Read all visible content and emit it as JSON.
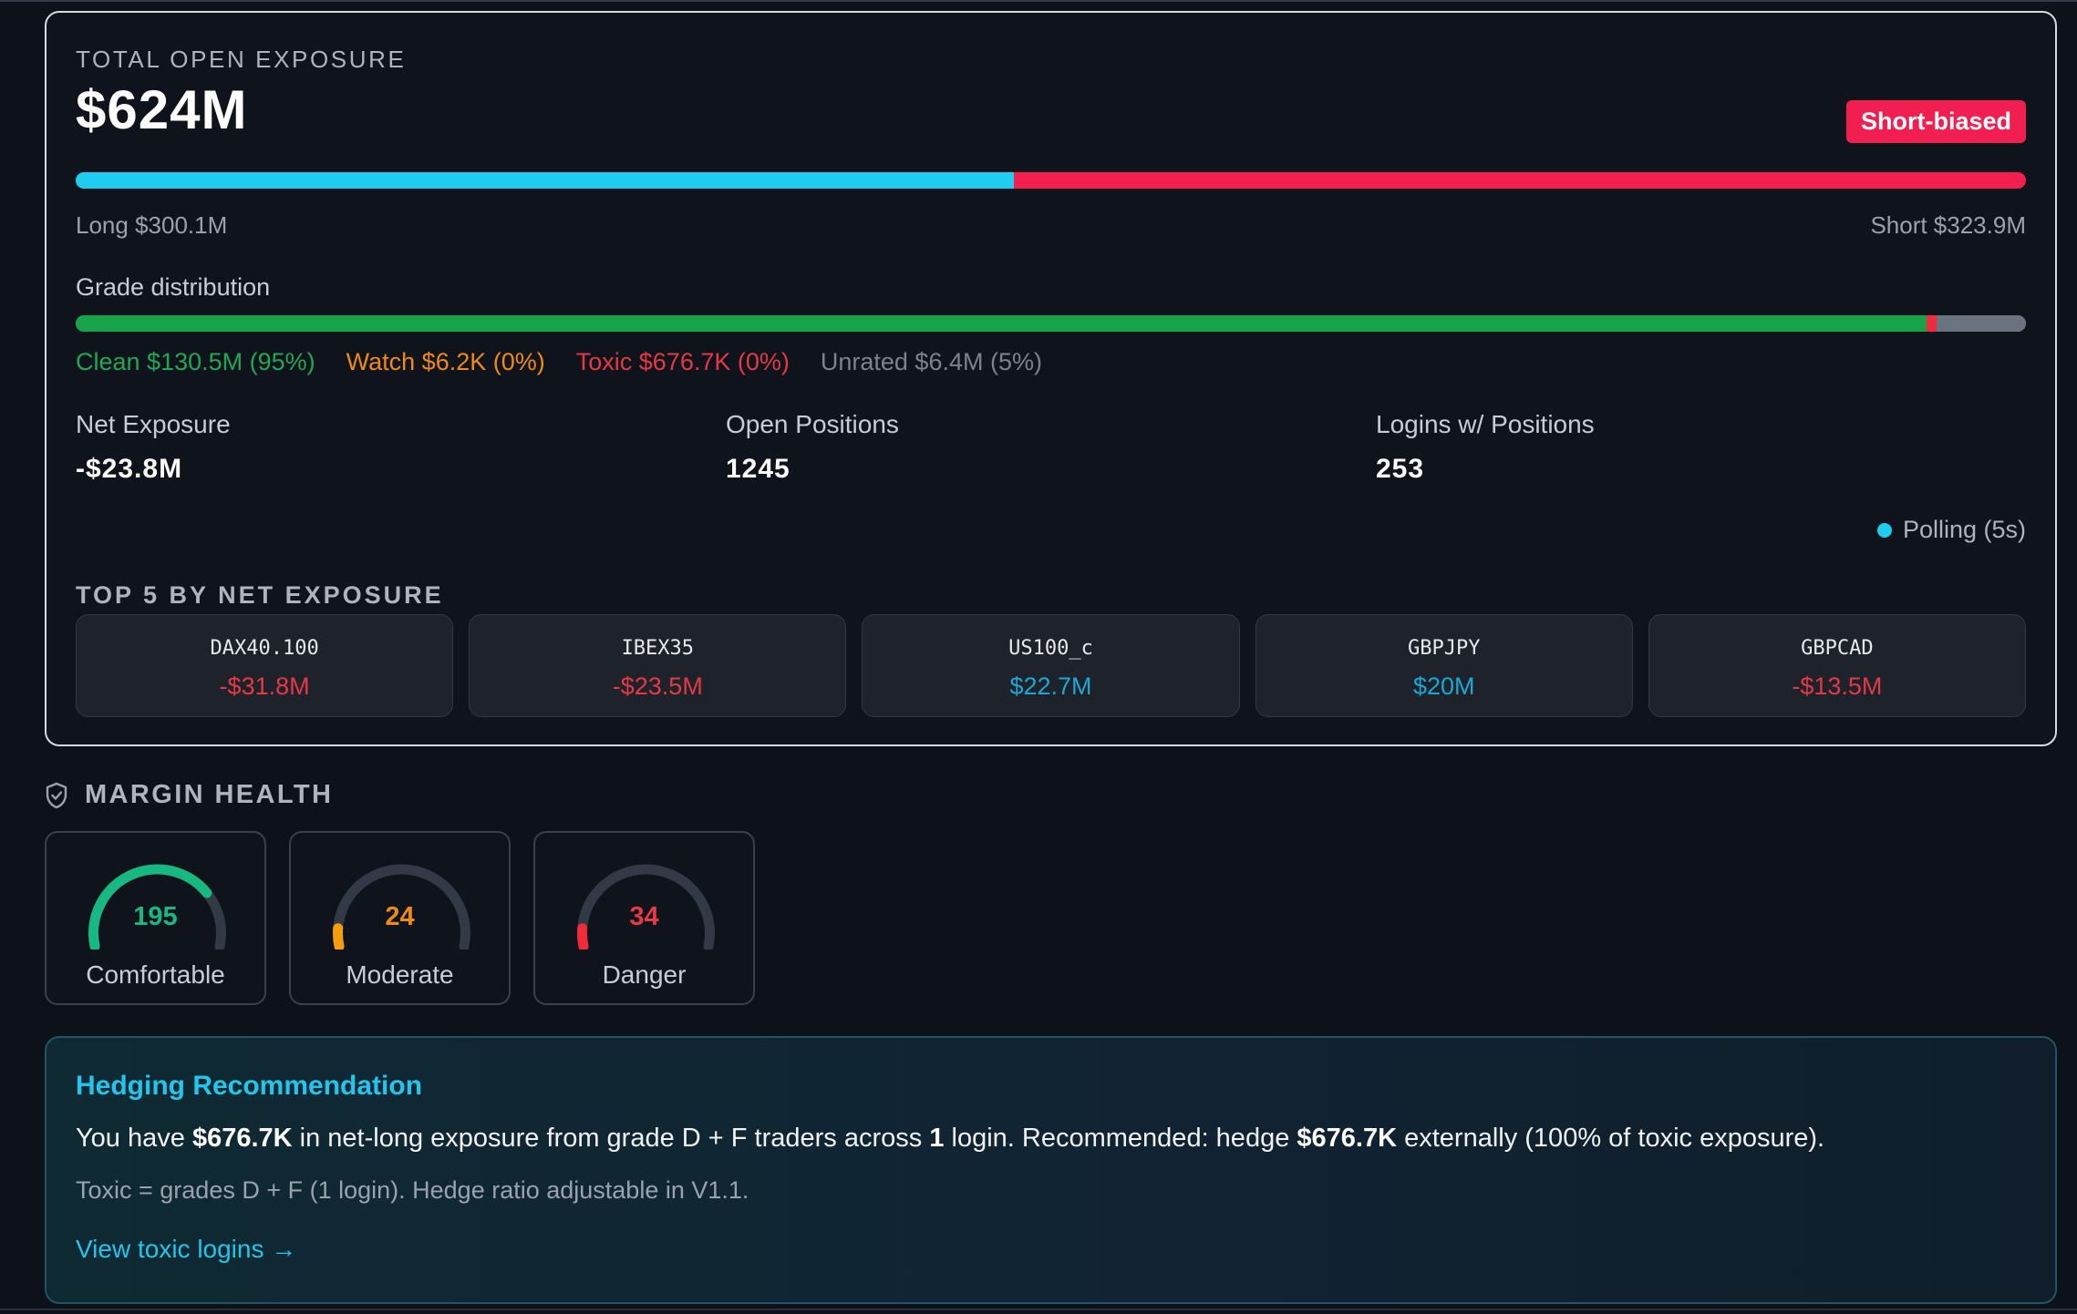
{
  "exposure": {
    "title": "TOTAL OPEN EXPOSURE",
    "total": "$624M",
    "bias_badge": "Short-biased",
    "long_label": "Long $300.1M",
    "short_label": "Short $323.9M",
    "long_fraction": 0.481,
    "grade": {
      "title": "Grade distribution",
      "segments_fraction": {
        "clean": 0.949,
        "watch": 0.0,
        "toxic": 0.005,
        "unrated": 0.046
      },
      "clean_label": "Clean $130.5M (95%)",
      "watch_label": "Watch $6.2K (0%)",
      "toxic_label": "Toxic $676.7K (0%)",
      "unrated_label": "Unrated $6.4M (5%)"
    },
    "stats": [
      {
        "label": "Net Exposure",
        "value": "-$23.8M"
      },
      {
        "label": "Open Positions",
        "value": "1245"
      },
      {
        "label": "Logins w/ Positions",
        "value": "253"
      }
    ],
    "polling": "Polling (5s)",
    "top5_title": "TOP 5 BY NET EXPOSURE",
    "top5": [
      {
        "symbol": "DAX40.100",
        "value": "-$31.8M"
      },
      {
        "symbol": "IBEX35",
        "value": "-$23.5M"
      },
      {
        "symbol": "US100_c",
        "value": "$22.7M"
      },
      {
        "symbol": "GBPJPY",
        "value": "$20M"
      },
      {
        "symbol": "GBPCAD",
        "value": "-$13.5M"
      }
    ]
  },
  "margin_health": {
    "title": "MARGIN HEALTH",
    "gauges": [
      {
        "value": "195",
        "label": "Comfortable",
        "level": 0.75,
        "color": "#16b981"
      },
      {
        "value": "24",
        "label": "Moderate",
        "level": 0.08,
        "color": "#f59e0b"
      },
      {
        "value": "34",
        "label": "Danger",
        "level": 0.08,
        "color": "#ef2b3c"
      }
    ]
  },
  "hedging": {
    "title": "Hedging Recommendation",
    "text_1": "You have ",
    "amount_1": "$676.7K",
    "text_2": " in net-long exposure from grade D + F traders across ",
    "count": "1",
    "text_3": " login. Recommended: hedge ",
    "amount_2": "$676.7K",
    "text_4": " externally (100% of toxic exposure).",
    "note": "Toxic = grades D + F (1 login). Hedge ratio adjustable in V1.1.",
    "link": "View toxic logins →"
  },
  "colors": {
    "long": "#1fcdf0",
    "short": "#f41f4f",
    "clean": "#16a34a",
    "watch": "#f59e0b",
    "toxic": "#ef2b3c",
    "unrated": "#6b7280",
    "accent": "#22c6ec"
  }
}
